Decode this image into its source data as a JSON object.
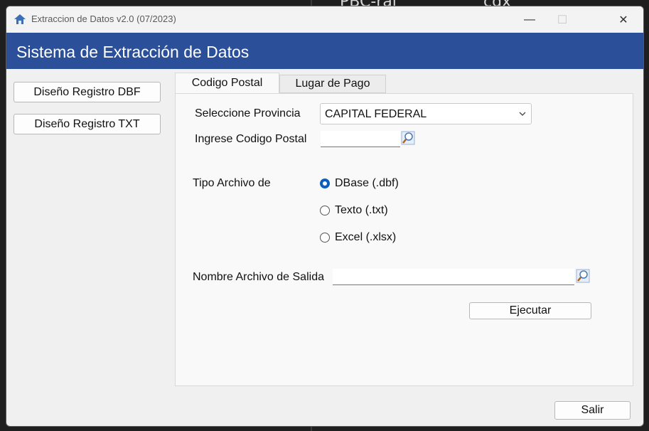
{
  "window": {
    "title": "Extraccion de Datos v2.0 (07/2023)",
    "minimize_glyph": "—",
    "maximize_glyph": "☐",
    "close_glyph": "✕"
  },
  "background": {
    "text_1": "PBC-ral",
    "text_2": "cdx"
  },
  "header": {
    "title": "Sistema de Extracción de Datos"
  },
  "sidebar": {
    "btn_dbf": "Diseño Registro DBF",
    "btn_txt": "Diseño Registro TXT"
  },
  "tabs": [
    {
      "label": "Codigo Postal",
      "active": true
    },
    {
      "label": "Lugar de Pago",
      "active": false
    }
  ],
  "form": {
    "provincia_label": "Seleccione Provincia",
    "provincia_value": "CAPITAL FEDERAL",
    "cp_label": "Ingrese Codigo Postal",
    "cp_value": "",
    "tipo_label": "Tipo Archivo de",
    "options": [
      {
        "label": "DBase (.dbf)",
        "selected": true
      },
      {
        "label": "Texto (.txt)",
        "selected": false
      },
      {
        "label": "Excel (.xlsx)",
        "selected": false
      }
    ],
    "salida_label": "Nombre Archivo de Salida",
    "salida_value": "",
    "ejecutar_label": "Ejecutar"
  },
  "footer": {
    "salir_label": "Salir"
  },
  "colors": {
    "banner": "#2b4f99",
    "radio_selected": "#0a5fbf"
  }
}
